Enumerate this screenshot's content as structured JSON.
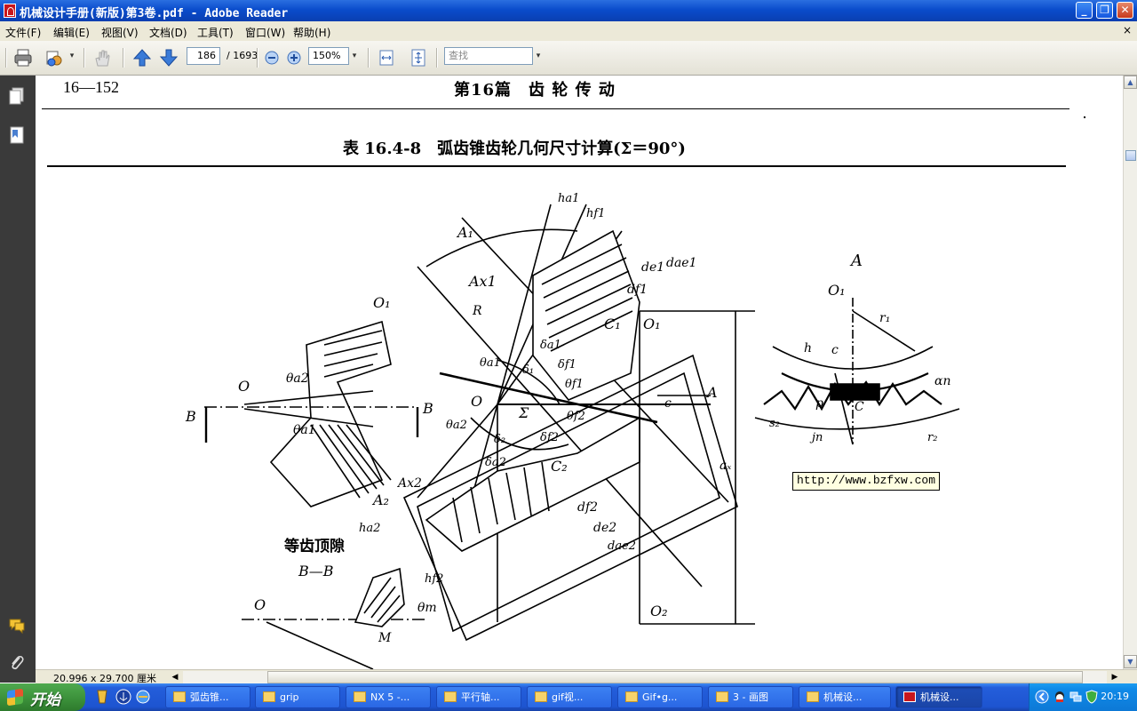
{
  "window": {
    "title": "机械设计手册(新版)第3卷.pdf - Adobe Reader",
    "min_glyph": "_",
    "max_glyph": "❐",
    "close_glyph": "✕"
  },
  "menu": {
    "items": [
      "文件(F)",
      "编辑(E)",
      "视图(V)",
      "文档(D)",
      "工具(T)",
      "窗口(W)",
      "帮助(H)"
    ],
    "close_glyph": "×"
  },
  "toolbar": {
    "current_page": "186",
    "total_pages": "/ 1693",
    "zoom": "150%",
    "search_placeholder": "查找"
  },
  "document": {
    "header_left": "16—152",
    "header_center": "第16篇　齿 轮 传 动",
    "table_title": "表 16.4-8　弧齿锥齿轮几何尺寸计算(Σ＝90°)",
    "labels": {
      "A_detail": "A",
      "O1_left": "O₁",
      "O_left": "O",
      "B_left": "B",
      "B_right": "B",
      "theta_a2": "θa2",
      "theta_a1_left": "θa1",
      "A1": "A₁",
      "Ax1": "Ax1",
      "R": "R",
      "ha1": "ha1",
      "hf1": "hf1",
      "dae1": "dae1",
      "de1": "de1",
      "df1": "df1",
      "O1_center": "O₁",
      "C1": "C₁",
      "delta_a1": "δa1",
      "delta1": "δ₁",
      "delta_f1": "δf1",
      "theta_f1": "θf1",
      "theta_a1": "θa1",
      "O_center": "O",
      "Sigma": "Σ",
      "theta_f2": "θf2",
      "theta_a2_center": "θa2",
      "delta2": "δ₂",
      "delta_f2": "δf2",
      "delta_a2": "δa2",
      "C2": "C₂",
      "A2": "A₂",
      "Ax2": "Ax2",
      "ha2": "ha2",
      "hf2": "hf2",
      "df2": "df2",
      "de2": "de2",
      "dae2": "dae2",
      "A_right": "A",
      "c_center": "c",
      "ax": "aₓ",
      "O2": "O₂",
      "equal_clearance": "等齿顶隙",
      "BB": "B—B",
      "O_bottom": "O",
      "theta_m": "θm",
      "M": "M",
      "O1_detail": "O₁",
      "r1": "r₁",
      "h": "h",
      "c_detail": "c",
      "alpha_n": "αn",
      "s2": "s₂",
      "p": "p",
      "C_detail": "C",
      "jn": "jn",
      "r2": "r₂"
    }
  },
  "tooltip": {
    "text": "http://www.bzfxw.com"
  },
  "status": {
    "page_size": "20.996 x 29.700 厘米"
  },
  "taskbar": {
    "start_label": "开始",
    "tasks": [
      "弧齿锥...",
      "grip",
      "NX 5 -...",
      "平行轴...",
      "gif视...",
      "Gif•g...",
      "3 - 画图",
      "机械设...",
      "机械设..."
    ],
    "clock": "20:19"
  },
  "colors": {
    "titlebar": "#0a4ccc",
    "taskbar": "#245edb",
    "start": "#3a8f39",
    "navpane": "#3a3a3a"
  }
}
